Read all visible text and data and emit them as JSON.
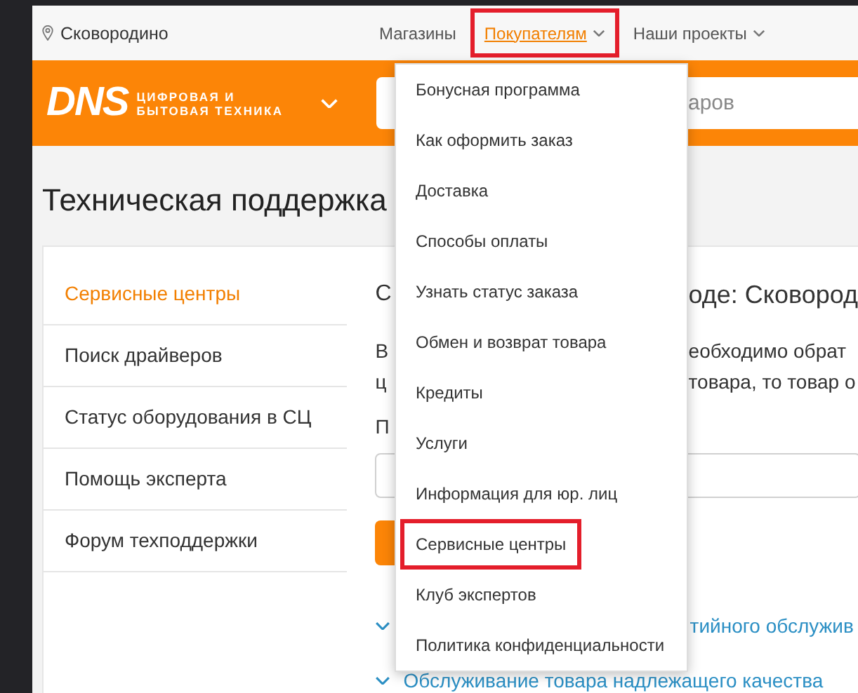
{
  "top_bar": {
    "location": "Сковородино",
    "nav": [
      {
        "label": "Магазины",
        "selected": false,
        "has_dropdown": false,
        "highlighted": false
      },
      {
        "label": "Покупателям",
        "selected": true,
        "has_dropdown": true,
        "highlighted": true
      },
      {
        "label": "Наши проекты",
        "selected": false,
        "has_dropdown": true,
        "highlighted": false
      }
    ]
  },
  "header": {
    "logo": {
      "mark": "DNS",
      "tagline": [
        "ЦИФРОВАЯ И",
        "БЫТОВАЯ ТЕХНИКА"
      ]
    },
    "search": {
      "placeholder": "аров"
    }
  },
  "heading": "Техническая поддержка",
  "sidebar": {
    "items": [
      {
        "label": "Сервисные центры",
        "selected": true
      },
      {
        "label": "Поиск драйверов",
        "selected": false
      },
      {
        "label": "Статус оборудования в СЦ",
        "selected": false
      },
      {
        "label": "Помощь эксперта",
        "selected": false
      },
      {
        "label": "Форум техподдержки",
        "selected": false
      }
    ]
  },
  "content": {
    "title": {
      "left": "С",
      "right": "оде: Сковород"
    },
    "paragraph": [
      {
        "left": "В",
        "right": "еобходимо обрат"
      },
      {
        "left": "ц",
        "right": "товара, то товар о"
      }
    ],
    "field_label": "П",
    "links": [
      {
        "text": "тийного обслужив",
        "expanded": false
      },
      {
        "text": "Обслуживание товара надлежащего качества",
        "expanded": false
      }
    ]
  },
  "dropdown": {
    "items": [
      {
        "label": "Бонусная программа",
        "highlighted": false
      },
      {
        "label": "Как оформить заказ",
        "highlighted": false
      },
      {
        "label": "Доставка",
        "highlighted": false
      },
      {
        "label": "Способы оплаты",
        "highlighted": false
      },
      {
        "label": "Узнать статус заказа",
        "highlighted": false
      },
      {
        "label": "Обмен и возврат товара",
        "highlighted": false
      },
      {
        "label": "Кредиты",
        "highlighted": false
      },
      {
        "label": "Услуги",
        "highlighted": false
      },
      {
        "label": "Информация для юр. лиц",
        "highlighted": false
      },
      {
        "label": "Сервисные центры",
        "highlighted": true
      },
      {
        "label": "Клуб экспертов",
        "highlighted": false
      },
      {
        "label": "Политика конфиденциальности",
        "highlighted": false
      }
    ]
  }
}
